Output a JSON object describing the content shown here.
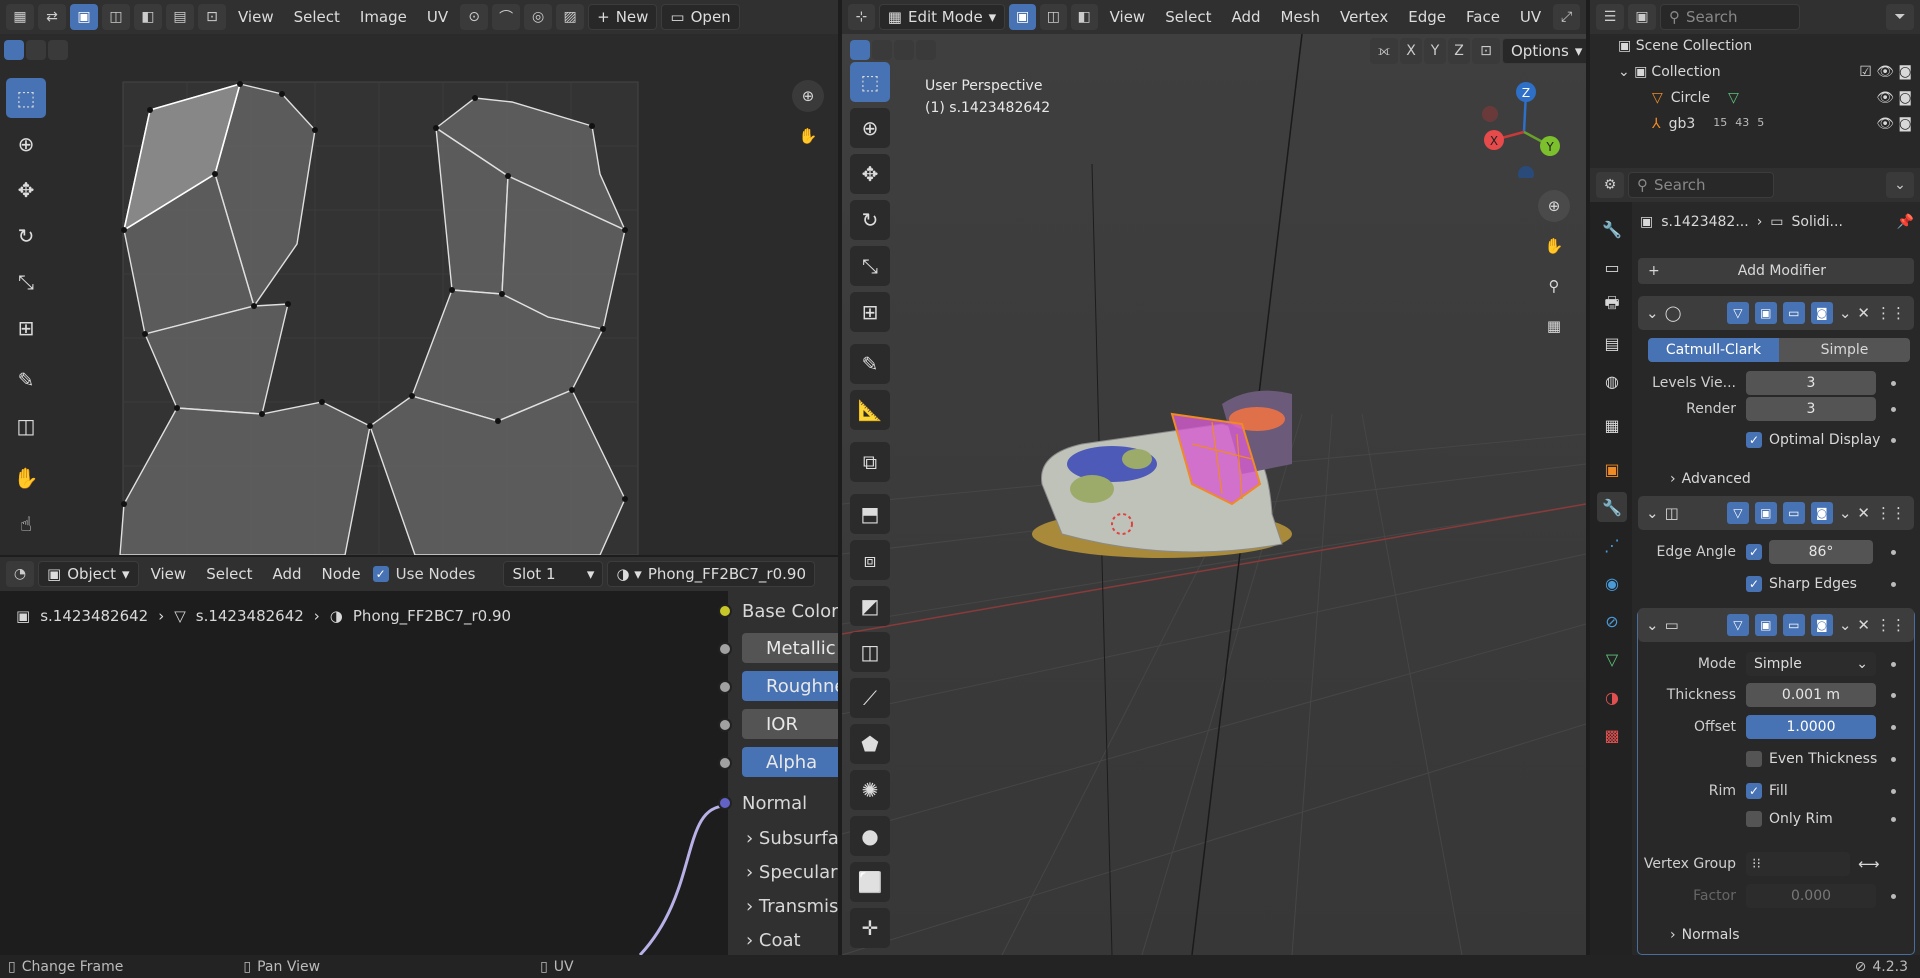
{
  "uv_editor": {
    "menus": [
      "View",
      "Select",
      "Image",
      "UV"
    ],
    "new_label": "New",
    "open_label": "Open"
  },
  "viewport": {
    "mode": "Edit Mode",
    "menus": [
      "View",
      "Select",
      "Add",
      "Mesh",
      "Vertex",
      "Edge",
      "Face",
      "UV"
    ],
    "overlay_title": "User Perspective",
    "overlay_object": "(1) s.1423482642",
    "axes": [
      "X",
      "Y",
      "Z"
    ],
    "options_label": "Options"
  },
  "node_editor": {
    "object_mode": "Object",
    "menus": [
      "View",
      "Select",
      "Add",
      "Node"
    ],
    "use_nodes_label": "Use Nodes",
    "slot": "Slot 1",
    "material": "Phong_FF2BC7_r0.90",
    "breadcrumb": [
      "s.1423482642",
      "s.1423482642",
      "Phong_FF2BC7_r0.90"
    ],
    "inputs": [
      "Base Color",
      "Metallic",
      "Roughness",
      "IOR",
      "Alpha",
      "Normal",
      "Subsurface",
      "Specular",
      "Transmission",
      "Coat"
    ]
  },
  "outliner": {
    "search_placeholder": "Search",
    "scene_collection": "Scene Collection",
    "collection": "Collection",
    "items": [
      {
        "name": "Circle"
      },
      {
        "name": "gb3",
        "badges": [
          "15",
          "43",
          "5"
        ]
      }
    ]
  },
  "properties": {
    "search_placeholder": "Search",
    "object_name": "s.1423482...",
    "modifier_name": "Solidi...",
    "add_modifier": "Add Modifier",
    "subsurf": {
      "tabs": [
        "Catmull-Clark",
        "Simple"
      ],
      "levels_label": "Levels Vie...",
      "levels_value": "3",
      "render_label": "Render",
      "render_value": "3",
      "optimal_display": "Optimal Display",
      "advanced": "Advanced"
    },
    "edge_split": {
      "edge_angle_label": "Edge Angle",
      "edge_angle_value": "86°",
      "sharp_edges": "Sharp Edges"
    },
    "solidify": {
      "mode_label": "Mode",
      "mode_value": "Simple",
      "thickness_label": "Thickness",
      "thickness_value": "0.001 m",
      "offset_label": "Offset",
      "offset_value": "1.0000",
      "even_thickness": "Even Thickness",
      "rim_label": "Rim",
      "fill_label": "Fill",
      "only_rim": "Only Rim",
      "vertex_group_label": "Vertex Group",
      "factor_label": "Factor",
      "factor_value": "0.000",
      "normals": "Normals"
    }
  },
  "status_bar": {
    "items": [
      "Change Frame",
      "Pan View",
      "UV"
    ],
    "version": "4.2.3"
  },
  "colors": {
    "accent": "#4772b3",
    "selection_orange": "#f08a24",
    "header": "#303030",
    "panel": "#2b2b2b"
  }
}
